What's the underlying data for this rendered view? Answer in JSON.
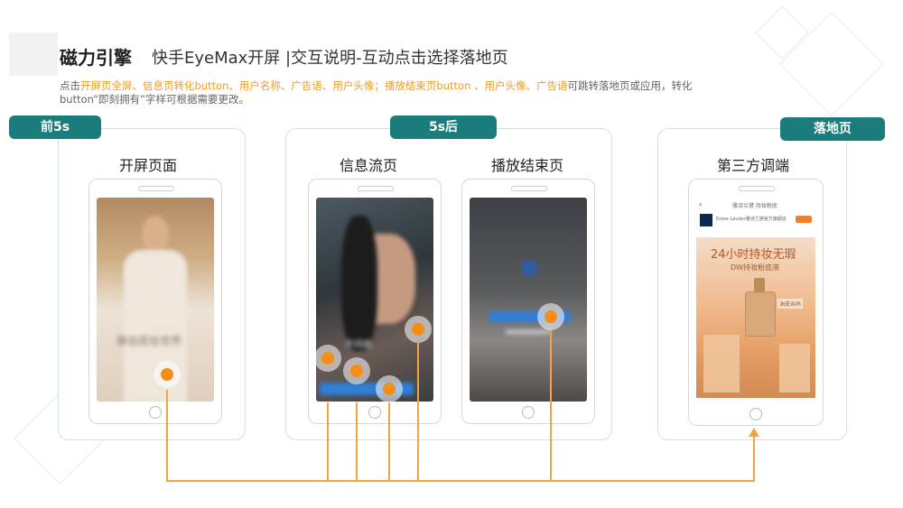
{
  "header": {
    "brand": "磁力引擎",
    "title": "快手EyeMax开屏 |交互说明-互动点击选择落地页"
  },
  "description": {
    "p1": "点击",
    "h1": "开屏页全屏、信息页转化button、用户名称、广告语、用户头像；播放结束页button 、用户头像、广告语",
    "p2": "可跳转落地页或应用，转化",
    "p3": "button“即刻拥有”字样可根据需要更改。"
  },
  "labels": {
    "before": "前5s",
    "after": "5s后",
    "landing": "落地页"
  },
  "captions": {
    "splash": "开屏页面",
    "feed": "信息流页",
    "end": "播放结束页",
    "third": "第三方调端"
  },
  "screens": {
    "splash_overlay": "静自底妆世界",
    "feed_overlay": "不闷痘",
    "lp_nav": "雅诗兰黛 持妆粉底",
    "lp_store": "Estee Lauder雅诗兰黛官方旗舰店",
    "lp_headline": "24小时持妆无瑕",
    "lp_sub": "DW持妆粉底液",
    "lp_tag": "油皮亲妈"
  },
  "colors": {
    "accent": "#f39a1e",
    "label_bg": "#1b7c7c",
    "line": "#f3a244"
  },
  "icons": [
    "tap-point-icon",
    "arrow-up-icon",
    "back-chevron-icon",
    "home-button-icon"
  ]
}
